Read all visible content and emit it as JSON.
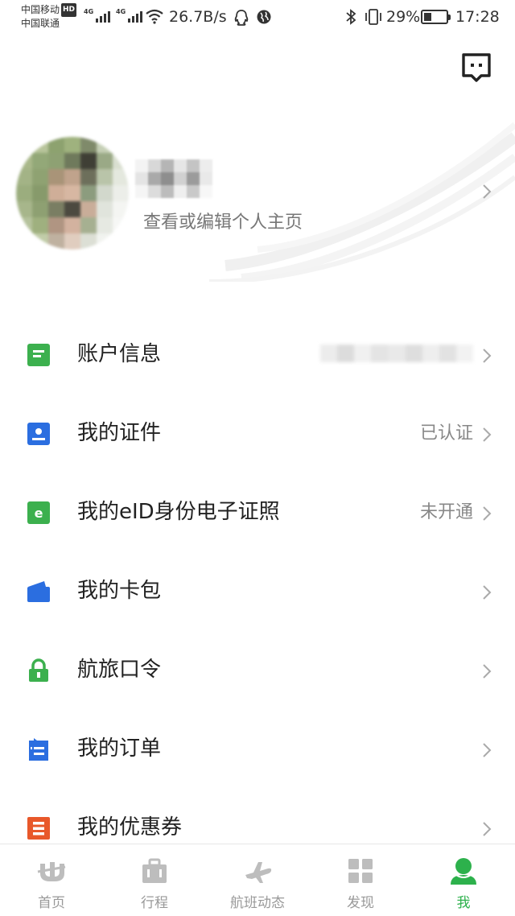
{
  "status_bar": {
    "carrier1": "中国移动",
    "hd_badge": "HD",
    "carrier2": "中国联通",
    "net1": "4G",
    "net2": "4G",
    "speed": "26.7B/s",
    "battery": "29%",
    "time": "17:28",
    "icons": [
      "signal-icon",
      "wifi-icon",
      "qq-icon",
      "globe-icon",
      "bluetooth-icon",
      "vibrate-icon",
      "battery-icon"
    ]
  },
  "header": {
    "message_icon": "chat-message-icon"
  },
  "profile": {
    "subtitle": "查看或编辑个人主页"
  },
  "menu": [
    {
      "label": "账户信息",
      "value": "",
      "icon": "account-info-icon",
      "color": "#3cb04e"
    },
    {
      "label": "我的证件",
      "value": "已认证",
      "icon": "id-card-icon",
      "color": "#2b6ee0"
    },
    {
      "label": "我的eID身份电子证照",
      "value": "未开通",
      "icon": "eid-icon",
      "color": "#3cb04e"
    },
    {
      "label": "我的卡包",
      "value": "",
      "icon": "card-wallet-icon",
      "color": "#2b6ee0"
    },
    {
      "label": "航旅口令",
      "value": "",
      "icon": "lock-icon",
      "color": "#3cb04e"
    },
    {
      "label": "我的订单",
      "value": "",
      "icon": "order-icon",
      "color": "#2b6ee0"
    },
    {
      "label": "我的优惠券",
      "value": "",
      "icon": "coupon-icon",
      "color": "#e8582a"
    }
  ],
  "tabs": [
    {
      "label": "首页",
      "icon": "home-logo-icon",
      "active": false
    },
    {
      "label": "行程",
      "icon": "briefcase-icon",
      "active": false
    },
    {
      "label": "航班动态",
      "icon": "airplane-icon",
      "active": false
    },
    {
      "label": "发现",
      "icon": "grid-icon",
      "active": false
    },
    {
      "label": "我",
      "icon": "person-icon",
      "active": true
    }
  ],
  "colors": {
    "accent_green": "#2db14c",
    "accent_blue": "#2b6ee0",
    "accent_orange": "#e8582a",
    "inactive_gray": "#999999"
  }
}
